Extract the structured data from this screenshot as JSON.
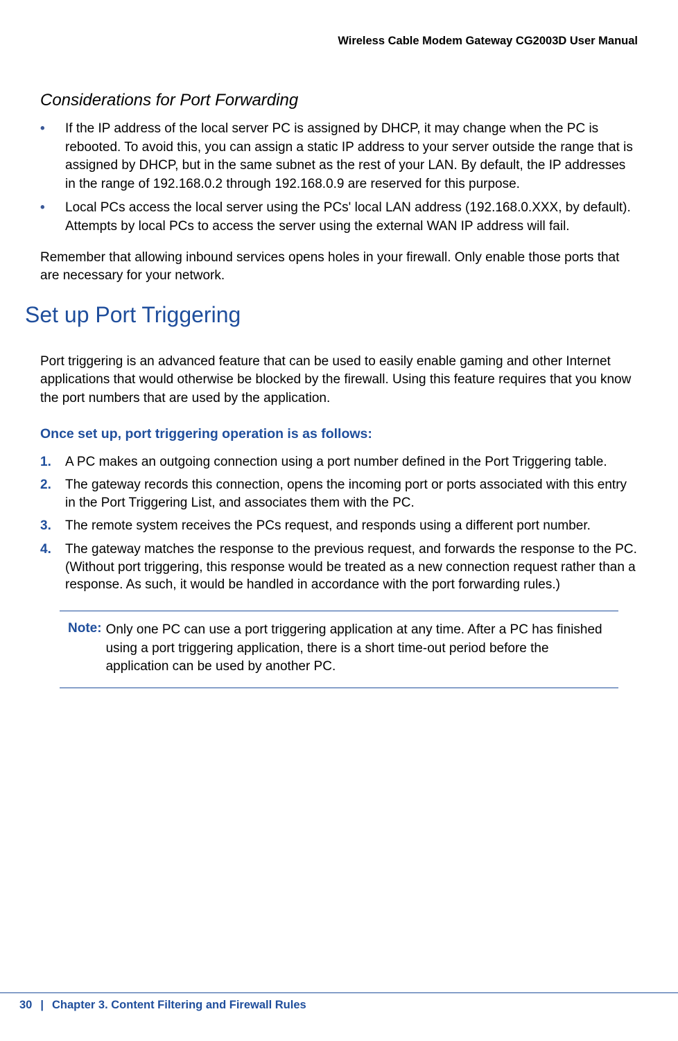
{
  "header": {
    "document_title": "Wireless Cable Modem Gateway CG2003D User Manual"
  },
  "section1": {
    "heading": "Considerations for Port Forwarding",
    "bullets": [
      "If the IP address of the local server PC is assigned by DHCP, it may change when the PC is rebooted. To avoid this, you can assign a static IP address to your server outside the range that is assigned by DHCP, but in the same subnet as the rest of your LAN. By default, the IP addresses in the range of 192.168.0.2 through 192.168.0.9 are reserved for this purpose.",
      "Local PCs access the local server using the PCs' local LAN address (192.168.0.XXX, by default). Attempts by local PCs to access the server using the external WAN IP address will fail."
    ],
    "closing_paragraph": "Remember that allowing inbound services opens holes in your firewall. Only enable those ports that are necessary for your network."
  },
  "section2": {
    "heading": "Set up Port Triggering",
    "intro_paragraph": "Port triggering is an advanced feature that can be used to easily enable gaming and other Internet applications that would otherwise be blocked by the firewall. Using this feature requires that you know the port numbers that are used by the application.",
    "subheading": "Once set up, port triggering operation is as follows:",
    "steps": [
      "A PC makes an outgoing connection using a port number defined in the Port Triggering table.",
      "The gateway records this connection, opens the incoming port or ports associated with this entry in the Port Triggering List, and associates them with the PC.",
      "The remote system receives the PCs request, and responds using a different port number.",
      "The gateway matches the response to the previous request, and forwards the response to the PC. (Without port triggering, this response would be treated as a new connection request rather than a response. As such, it would be handled in accordance with the port forwarding rules.)"
    ],
    "note": {
      "label": "Note:",
      "text": "Only one PC can use a port triggering application at any time. After a PC has finished using a port triggering application, there is a short time-out period before the application can be used by another PC."
    }
  },
  "footer": {
    "page_number": "30",
    "separator": "|",
    "chapter": "Chapter 3.  Content Filtering and Firewall Rules"
  }
}
